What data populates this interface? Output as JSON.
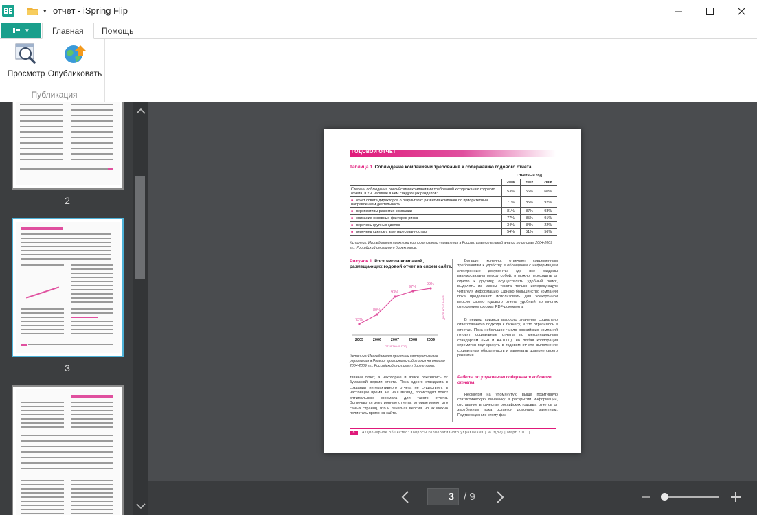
{
  "window": {
    "title": "отчет - iSpring Flip"
  },
  "ribbon": {
    "tabs": [
      {
        "label": "Главная",
        "active": true
      },
      {
        "label": "Помощь",
        "active": false
      }
    ],
    "group": {
      "label": "Публикация",
      "buttons": [
        {
          "label": "Просмотр",
          "icon": "magnifier-icon"
        },
        {
          "label": "Опубликовать",
          "icon": "globe-upload-icon"
        }
      ]
    }
  },
  "thumbnails": [
    {
      "number": "2",
      "selected": false
    },
    {
      "number": "3",
      "selected": true
    },
    {
      "number": "",
      "selected": false
    }
  ],
  "document_page": {
    "banner": "ГОДОВОЙ ОТЧЕТ",
    "table_title_prefix": "Таблица 1.",
    "table_title": "Соблюдение компаниями требований к содержанию годового отчета.",
    "table_header": "Отчетный год",
    "years": [
      "2006",
      "2007",
      "2008"
    ],
    "rows": [
      {
        "label": "Степень соблюдения российскими компаниями требований к содержанию годового отчета, в т.ч. наличие в нем следующих разделов:",
        "bullet": false,
        "values": [
          "53%",
          "56%",
          "60%"
        ]
      },
      {
        "label": "отчет совета директоров о результатах развития компании по приоритетным направлениям деятельности",
        "bullet": true,
        "values": [
          "71%",
          "85%",
          "92%"
        ]
      },
      {
        "label": "перспективы развития компании",
        "bullet": true,
        "values": [
          "81%",
          "87%",
          "93%"
        ]
      },
      {
        "label": "описание основных факторов риска",
        "bullet": true,
        "values": [
          "77%",
          "85%",
          "91%"
        ]
      },
      {
        "label": "перечень крупных сделок",
        "bullet": true,
        "values": [
          "34%",
          "34%",
          "22%"
        ]
      },
      {
        "label": "перечень сделок с заинтересованностью",
        "bullet": true,
        "values": [
          "54%",
          "51%",
          "56%"
        ]
      }
    ],
    "table_source": "Источник: Исследования практики корпоративного управления в России: сравнительный анализ по итогам 2004-2009 гг., Российский институт директоров.",
    "figure_title_prefix": "Рисунок 1.",
    "figure_title": "Рост числа компаний, размещающих годовой отчет на своем сайте.",
    "figure_source": "Источник: Исследования практики корпоративного управления в России: сравнительный анализ по итогам 2004-2009 гг., Российский институт директоров.",
    "col_left_text": "тивный отчет, а некоторые и вовсе отказались от бумажной версии отчета. Пока одного стандарта в создании интерактивного отчета не существует, в настоящее время, на наш взгляд, происходит поиск оптимального формата для такого отчета. Встречаются электронные отчеты, которые имеют это самых страниц, что и печатная версия, но их можно полистать прямо на сайте.",
    "col_right_text": "Больше, конечно, отвечают современным требованиям к удобству в обращении с информацией электронные документы, где все разделы взаимосвязаны между собой, и можно переходить от одного к другому, осуществлять удобный поиск, выделять из массы текста только интересующую читателя информацию. Однако большинство компаний пока продолжают использовать для электронной версии своего годового отчета удобный во многих отношениях формат PDF-документа.",
    "col_right_text2": "В период кризиса выросло значение социально ответственного подхода к бизнесу, и это отразилось в отчетах. Пока небольшое число российских компаний готовят социальные отчеты по международным стандартам (GRI и AA1000), но любая корпорация стремится подчеркнуть в годовом отчете выполнение социальных обязательств и завоевать доверие своего развития.",
    "subheading": "Работа по улучшению содержания годового отчета",
    "col_right_text3": "Несмотря на упомянутую выше позитивную статистическую динамику в раскрытии информации, отставание в качестве российских годовых отчетов от зарубежных пока остается довольно заметным. Подтверждению этому фак-",
    "footer_page": "8",
    "footer_text": "Акционерное общество: вопросы корпоративного управления | № 3(82) | Март 2011 |"
  },
  "chart_data": {
    "type": "line",
    "x": [
      "2005",
      "2006",
      "2007",
      "2008",
      "2009"
    ],
    "values": [
      73,
      80,
      93,
      97,
      99
    ],
    "labels": [
      "73%",
      "80%",
      "93%",
      "97%",
      "99%"
    ],
    "xlabel": "ОТЧЕТНЫЙ ГОД",
    "ylabel": "ДОЛЯ КОМПАНИЙ",
    "color": "#e0509f"
  },
  "pager": {
    "current": "3",
    "total": "/ 9"
  },
  "zoom": {
    "level": 0.0
  },
  "colors": {
    "accent": "#1a9f8c",
    "document_pink": "#e0197a",
    "viewer_bg": "#4a4c4f"
  }
}
